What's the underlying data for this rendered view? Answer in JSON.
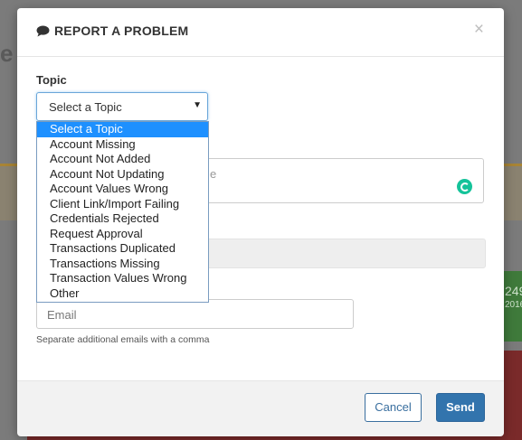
{
  "modal": {
    "title": "REPORT A PROBLEM",
    "close_glyph": "×",
    "icon": "chat-bubble-icon"
  },
  "topic": {
    "label": "Topic",
    "selected": "Select a Topic",
    "options": [
      "Select a Topic",
      "Account Missing",
      "Account Not Added",
      "Account Not Updating",
      "Account Values Wrong",
      "Client Link/Import Failing",
      "Credentials Rejected",
      "Request Approval",
      "Transactions Duplicated",
      "Transactions Missing",
      "Transaction Values Wrong",
      "Other"
    ]
  },
  "description": {
    "visible_fragment": "e"
  },
  "email": {
    "placeholder": "Email",
    "help": "Separate additional emails with a comma"
  },
  "footer": {
    "cancel_label": "Cancel",
    "send_label": "Send"
  },
  "background": {
    "title_fragment": "e (",
    "green_tile_value": "249",
    "green_tile_sub": "2016"
  },
  "colors": {
    "primary": "#3274ad",
    "selected_option": "#1e90ff",
    "grammarly": "#15c39a"
  }
}
